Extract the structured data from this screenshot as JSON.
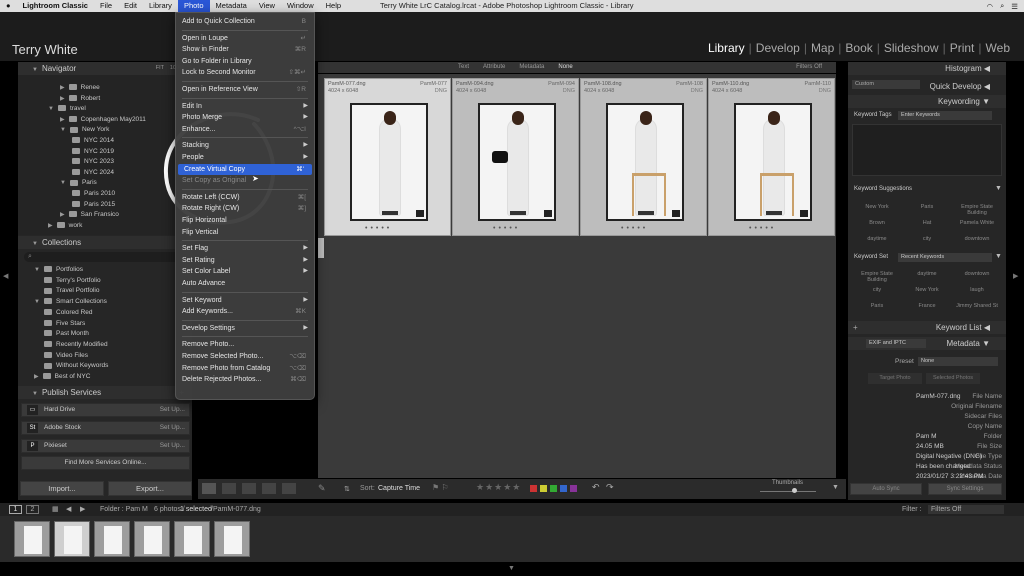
{
  "macmenu": {
    "apple": "",
    "items": [
      "Lightroom Classic",
      "File",
      "Edit",
      "Library",
      "Photo",
      "Metadata",
      "View",
      "Window",
      "Help"
    ],
    "active": "Photo"
  },
  "window_title": "Terry White LrC Catalog.lrcat - Adobe Photoshop Lightroom Classic - Library",
  "tray": {
    "clock": "",
    "wifi": "wifi-icon"
  },
  "identity": {
    "name": "Terry White",
    "modules": [
      "Library",
      "Develop",
      "Map",
      "Book",
      "Slideshow",
      "Print",
      "Web"
    ],
    "active_module": "Library"
  },
  "navigator": {
    "title": "Navigator",
    "zoom": [
      "FIT",
      "100%"
    ]
  },
  "folders": [
    {
      "label": "Renee",
      "indent": 2
    },
    {
      "label": "Robert",
      "indent": 2
    },
    {
      "label": "travel",
      "indent": 1,
      "open": true
    },
    {
      "label": "Copenhagen May2011",
      "indent": 2
    },
    {
      "label": "New York",
      "indent": 2,
      "open": true
    },
    {
      "label": "NYC 2014",
      "indent": 3
    },
    {
      "label": "NYC 2019",
      "indent": 3
    },
    {
      "label": "NYC 2023",
      "indent": 3
    },
    {
      "label": "NYC 2024",
      "indent": 3
    },
    {
      "label": "Paris",
      "indent": 2,
      "open": true
    },
    {
      "label": "Paris 2010",
      "indent": 3
    },
    {
      "label": "Paris 2015",
      "indent": 3
    },
    {
      "label": "San Fransico",
      "indent": 2
    },
    {
      "label": "work",
      "indent": 1
    }
  ],
  "collections": {
    "title": "Collections",
    "items": [
      {
        "label": "Portfolios",
        "indent": 1,
        "open": true
      },
      {
        "label": "Terry's Portfolio",
        "indent": 2
      },
      {
        "label": "Travel Portfolio",
        "indent": 2
      },
      {
        "label": "Smart Collections",
        "indent": 1,
        "open": true
      },
      {
        "label": "Colored Red",
        "indent": 2
      },
      {
        "label": "Five Stars",
        "indent": 2
      },
      {
        "label": "Past Month",
        "indent": 2
      },
      {
        "label": "Recently Modified",
        "indent": 2
      },
      {
        "label": "Video Files",
        "indent": 2
      },
      {
        "label": "Without Keywords",
        "indent": 2
      },
      {
        "label": "Best of NYC",
        "indent": 1
      }
    ]
  },
  "publish": {
    "title": "Publish Services",
    "services": [
      {
        "label": "Hard Drive",
        "icon": "hard-drive-icon",
        "setup": "Set Up..."
      },
      {
        "label": "Adobe Stock",
        "icon": "adobe-stock-icon",
        "setup": "Set Up..."
      },
      {
        "label": "Pixieset",
        "icon": "pixieset-icon",
        "setup": "Set Up..."
      }
    ],
    "find_more": "Find More Services Online..."
  },
  "bottom_buttons": {
    "import": "Import...",
    "export": "Export..."
  },
  "filterbar": {
    "items": [
      "Text",
      "Attribute",
      "Metadata",
      "None"
    ],
    "active": "None",
    "filters": "Filters Off"
  },
  "grid": [
    {
      "name": "PamM-077.dng",
      "num": "PamM-077",
      "dims": "4024 x 6048",
      "type": "DNG",
      "selected": true
    },
    {
      "name": "PamM-094.dng",
      "num": "PamM-094",
      "dims": "4024 x 6048",
      "type": "DNG",
      "selected": false
    },
    {
      "name": "PamM-108.dng",
      "num": "PamM-108",
      "dims": "4024 x 6048",
      "type": "DNG",
      "selected": false
    },
    {
      "name": "PamM-110.dng",
      "num": "PamM-110",
      "dims": "4024 x 6048",
      "type": "DNG",
      "selected": false
    }
  ],
  "toolbar": {
    "sort_label": "Sort:",
    "sort_value": "Capture Time",
    "thumbnails": "Thumbnails"
  },
  "right": {
    "histogram": "Histogram",
    "quickdev": {
      "title": "Quick Develop",
      "preset": "Custom"
    },
    "keywording": {
      "title": "Keywording",
      "tags_label": "Keyword Tags",
      "tags_value": "Enter Keywords"
    },
    "suggestions": {
      "title": "Keyword Suggestions",
      "items": [
        "New York",
        "Paris",
        "Empire State Building",
        "Brown",
        "Hat",
        "Pamela White",
        "daytime",
        "city",
        "downtown"
      ]
    },
    "keyword_set": {
      "label": "Keyword Set",
      "value": "Recent Keywords",
      "items": [
        "Empire State Building",
        "daytime",
        "downtown",
        "city",
        "New York",
        "laugh",
        "Paris",
        "France",
        "Jimmy Shared St"
      ]
    },
    "keyword_list": "Keyword List",
    "metadata": {
      "title": "Metadata",
      "preset_source": "EXIF and IPTC",
      "preset_label": "Preset",
      "preset_value": "None",
      "preset_buttons": [
        "Target Photo",
        "Selected Photos"
      ],
      "fields": [
        {
          "k": "File Name",
          "v": "PamM-077.dng"
        },
        {
          "k": "Original Filename",
          "v": ""
        },
        {
          "k": "Sidecar Files",
          "v": ""
        },
        {
          "k": "Copy Name",
          "v": ""
        },
        {
          "k": "Folder",
          "v": "Pam M"
        },
        {
          "k": "File Size",
          "v": "24.05 MB"
        },
        {
          "k": "File Type",
          "v": "Digital Negative (DNG)"
        },
        {
          "k": "Metadata Status",
          "v": "Has been changed"
        },
        {
          "k": "Metadata Date",
          "v": "2023/01/27 3:22:43 PM"
        }
      ]
    },
    "sync_buttons": [
      "Auto Sync",
      "Sync Settings"
    ]
  },
  "filmstrip": {
    "pages": [
      "1",
      "2"
    ],
    "folder": "Folder : Pam M",
    "count": "6 photos /",
    "selected": "1 selected",
    "file": "/PamM-077.dng",
    "filter_label": "Filter :",
    "filter_value": "Filters Off"
  },
  "photo_menu": {
    "items": [
      {
        "label": "Add to Quick Collection",
        "sc": "B"
      },
      {
        "sep": true
      },
      {
        "label": "Open in Loupe",
        "sc": "↵"
      },
      {
        "label": "Show in Finder",
        "sc": "⌘R"
      },
      {
        "label": "Go to Folder in Library",
        "sc": ""
      },
      {
        "label": "Lock to Second Monitor",
        "sc": "⇧⌘↵"
      },
      {
        "sep": true
      },
      {
        "label": "Open in Reference View",
        "sc": "⇧R"
      },
      {
        "sep": true
      },
      {
        "label": "Edit In",
        "arrow": true
      },
      {
        "label": "Photo Merge",
        "arrow": true
      },
      {
        "label": "Enhance...",
        "sc": "^⌥I"
      },
      {
        "sep": true
      },
      {
        "label": "Stacking",
        "arrow": true
      },
      {
        "label": "People",
        "arrow": true
      },
      {
        "label": "Create Virtual Copy",
        "sc": "⌘'",
        "hl": true
      },
      {
        "label": "Set Copy as Original",
        "dis": true
      },
      {
        "sep": true
      },
      {
        "label": "Rotate Left (CCW)",
        "sc": "⌘["
      },
      {
        "label": "Rotate Right (CW)",
        "sc": "⌘]"
      },
      {
        "label": "Flip Horizontal",
        "sc": ""
      },
      {
        "label": "Flip Vertical",
        "sc": ""
      },
      {
        "sep": true
      },
      {
        "label": "Set Flag",
        "arrow": true
      },
      {
        "label": "Set Rating",
        "arrow": true
      },
      {
        "label": "Set Color Label",
        "arrow": true
      },
      {
        "label": "Auto Advance",
        "sc": ""
      },
      {
        "sep": true
      },
      {
        "label": "Set Keyword",
        "arrow": true
      },
      {
        "label": "Add Keywords...",
        "sc": "⌘K"
      },
      {
        "sep": true
      },
      {
        "label": "Develop Settings",
        "arrow": true
      },
      {
        "sep": true
      },
      {
        "label": "Remove Photo...",
        "sc": ""
      },
      {
        "label": "Remove Selected Photo...",
        "sc": "⌥⌫"
      },
      {
        "label": "Remove Photo from Catalog",
        "sc": "⌥⌫"
      },
      {
        "label": "Delete Rejected Photos...",
        "sc": "⌘⌫"
      }
    ]
  }
}
